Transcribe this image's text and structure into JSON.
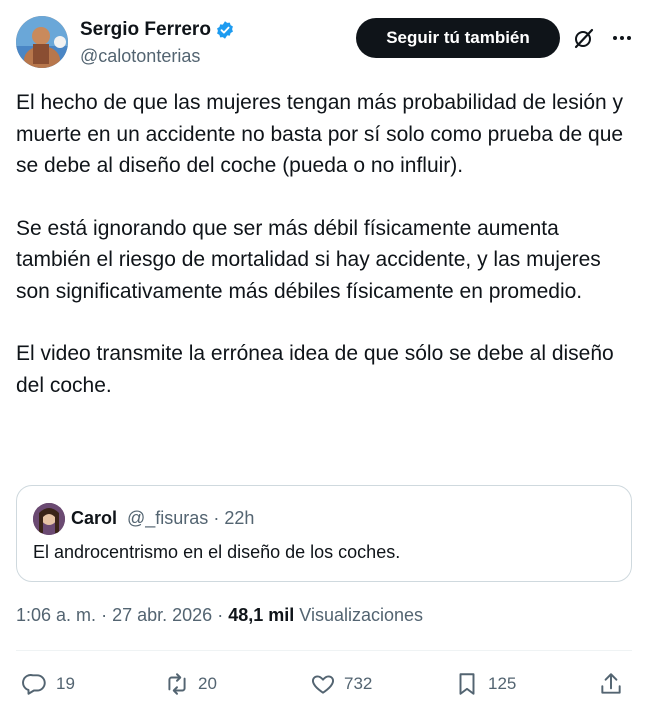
{
  "author": {
    "display_name": "Sergio Ferrero",
    "handle": "@calotonterias",
    "verified_icon": "verified-badge-icon",
    "verified_color": "#1d9bf0"
  },
  "header": {
    "follow_label": "Seguir tú también",
    "grok_icon": "grok-icon",
    "more_icon": "more-icon"
  },
  "tweet": {
    "paragraphs": [
      "El hecho de que las mujeres tengan más probabilidad de lesión y muerte en un accidente no basta por sí solo como prueba de que se debe al diseño del coche (pueda o no influir).",
      "Se está ignorando que ser más débil físicamente aumenta también el riesgo de mortalidad si hay accidente, y las mujeres son significativamente más débiles físicamente en promedio.",
      "El video transmite la errónea idea de que sólo se debe al diseño del coche."
    ]
  },
  "quote": {
    "name": "Carol",
    "handle": "@_fisuras",
    "separator": "·",
    "time": "22h",
    "text": "El androcentrismo en el diseño de los coches."
  },
  "meta": {
    "time": "1:06 a. m.",
    "date": "27 abr. 2026",
    "separator": "·",
    "views_count": "48,1 mil",
    "views_label": "Visualizaciones"
  },
  "actions": {
    "replies": "19",
    "reposts": "20",
    "likes": "732",
    "bookmarks": "125",
    "reply_icon": "reply-icon",
    "repost_icon": "repost-icon",
    "like_icon": "heart-icon",
    "bookmark_icon": "bookmark-icon",
    "share_icon": "share-icon"
  }
}
